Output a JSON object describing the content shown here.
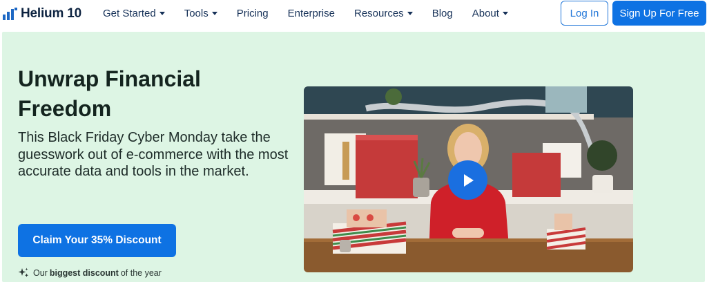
{
  "brand": {
    "name": "Helium 10",
    "color": "#1d68c4"
  },
  "nav": {
    "items": [
      {
        "label": "Get Started",
        "dropdown": true
      },
      {
        "label": "Tools",
        "dropdown": true
      },
      {
        "label": "Pricing",
        "dropdown": false
      },
      {
        "label": "Enterprise",
        "dropdown": false
      },
      {
        "label": "Resources",
        "dropdown": true
      },
      {
        "label": "Blog",
        "dropdown": false
      },
      {
        "label": "About",
        "dropdown": true
      }
    ],
    "login_label": "Log In",
    "signup_label": "Sign Up For Free"
  },
  "hero": {
    "title": "Unwrap Financial Freedom",
    "subtitle": "This Black Friday Cyber Monday take the guesswork out of e-commerce with the most accurate data and tools in the market.",
    "cta_label": "Claim Your 35% Discount",
    "note_prefix": "Our",
    "note_bold": "biggest discount",
    "note_suffix": "of the year",
    "background_color": "#ddf5e4",
    "accent_color": "#0e72e3"
  },
  "video": {
    "play_icon": "play-icon"
  }
}
